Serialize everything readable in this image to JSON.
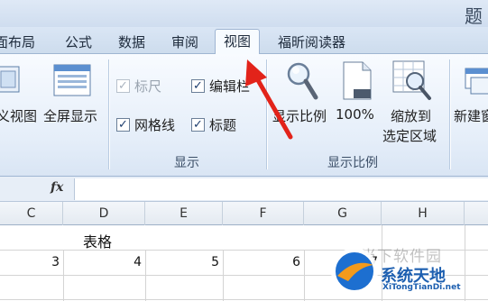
{
  "window": {
    "title_fragment": "题"
  },
  "tabs": [
    {
      "label": "面布局"
    },
    {
      "label": "公式"
    },
    {
      "label": "数据"
    },
    {
      "label": "审阅"
    },
    {
      "label": "视图",
      "active": true
    },
    {
      "label": "福昕阅读器"
    }
  ],
  "ribbon": {
    "views": {
      "custom_view": "义视图",
      "full_screen": "全屏显示"
    },
    "show_group": {
      "label": "显示",
      "checkboxes": [
        {
          "label": "标尺",
          "checked": true,
          "enabled": false
        },
        {
          "label": "编辑栏",
          "checked": true,
          "enabled": true
        },
        {
          "label": "网格线",
          "checked": true,
          "enabled": true
        },
        {
          "label": "标题",
          "checked": true,
          "enabled": true
        }
      ]
    },
    "zoom_group": {
      "label": "显示比例",
      "zoom_button": "显示比例",
      "hundred_button": "100%",
      "zoom_selection_line1": "缩放到",
      "zoom_selection_line2": "选定区域"
    },
    "window_group": {
      "new_window": "新建窗"
    }
  },
  "formula_bar": {
    "fx_label": "fx",
    "value": ""
  },
  "columns": [
    "C",
    "D",
    "E",
    "F",
    "G",
    "H"
  ],
  "sheet": {
    "merged_title": "表格",
    "row1_values": [
      "3",
      "4",
      "5",
      "6",
      "7"
    ]
  },
  "watermark": {
    "faded_text": "当下软件园",
    "brand": "系统天地",
    "url": "XiTongTianDi.net"
  },
  "colors": {
    "arrow": "#e2231a",
    "accent": "#1d5fb0"
  }
}
